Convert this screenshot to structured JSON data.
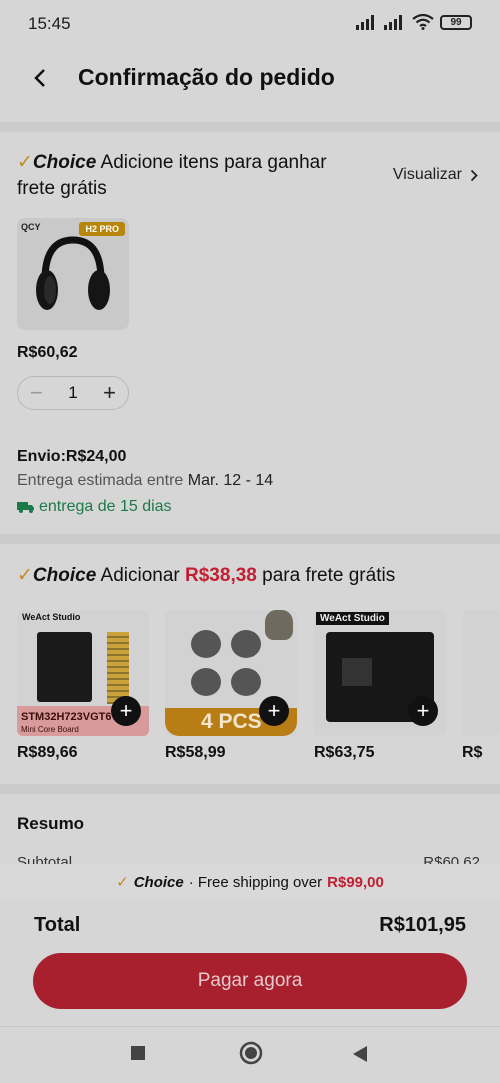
{
  "status": {
    "time": "15:45",
    "battery": "99"
  },
  "header": {
    "title": "Confirmação do pedido"
  },
  "choice_section": {
    "brand": "Choice",
    "check": "✓",
    "title": "Adicione itens para ganhar frete grátis",
    "view_label": "Visualizar",
    "product": {
      "brand_logo": "QCY",
      "badge": "H2 PRO",
      "price": "R$60,62",
      "quantity": "1"
    },
    "shipping_label": "Envio:R$24,00",
    "estimate_prefix": "Entrega estimada entre",
    "estimate_dates": "Mar. 12 - 14",
    "delivery_days": "entrega de 15 dias"
  },
  "recommend_section": {
    "brand": "Choice",
    "check": "✓",
    "prefix": "Adicionar",
    "amount": "R$38,38",
    "suffix": "para frete grátis",
    "items": [
      {
        "price": "R$89,66",
        "top_label": "WeAct Studio",
        "main_label": "STM32H723VGT6",
        "sub_label": "Mini Core Board"
      },
      {
        "price": "R$58,99",
        "main_label": "4 PCS"
      },
      {
        "price": "R$63,75",
        "top_label": "WeAct Studio"
      },
      {
        "price": "R$"
      }
    ]
  },
  "summary": {
    "title": "Resumo",
    "subtotal_label": "Subtotal",
    "subtotal_value": "R$60,62"
  },
  "promo": {
    "brand": "Choice",
    "text": "· Free shipping over",
    "amount": "R$99,00"
  },
  "total": {
    "label": "Total",
    "value": "R$101,95"
  },
  "pay_button": "Pagar agora",
  "colors": {
    "accent_red": "#c21e32",
    "button_red": "#a8202e",
    "choice_gold": "#c98a1a",
    "delivery_green": "#1c7a4a"
  }
}
